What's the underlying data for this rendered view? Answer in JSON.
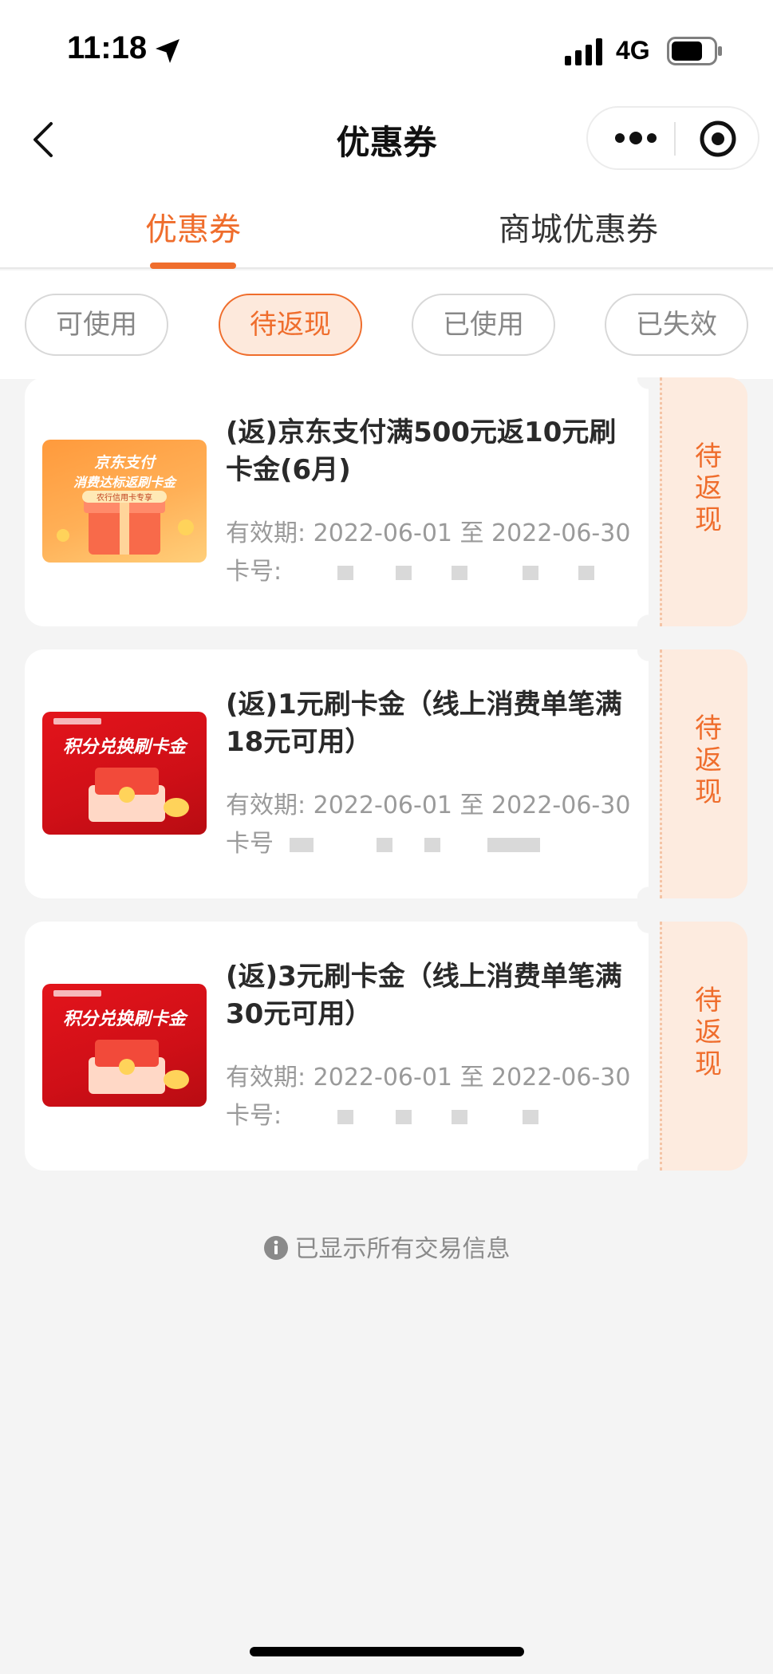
{
  "status_bar": {
    "time": "11:18",
    "network": "4G"
  },
  "nav": {
    "title": "优惠券"
  },
  "tabs": [
    {
      "label": "优惠券"
    },
    {
      "label": "商城优惠券"
    }
  ],
  "filters": [
    {
      "label": "可使用"
    },
    {
      "label": "待返现"
    },
    {
      "label": "已使用"
    },
    {
      "label": "已失效"
    }
  ],
  "coupons": [
    {
      "title": "(返)京东支付满500元返10元刷卡金(6月)",
      "validity": "有效期: 2022-06-01 至 2022-06-30",
      "card": "卡号:",
      "status": "待返现",
      "image": {
        "line1": "京东支付",
        "line2": "消费达标返刷卡金",
        "line3": "农行信用卡专享"
      }
    },
    {
      "title": "(返)1元刷卡金（线上消费单笔满18元可用）",
      "validity": "有效期: 2022-06-01 至 2022-06-30",
      "card": "卡号",
      "status": "待返现",
      "image": {
        "line1": "积分兑换刷卡金"
      }
    },
    {
      "title": "(返)3元刷卡金（线上消费单笔满30元可用）",
      "validity": "有效期: 2022-06-01 至 2022-06-30",
      "card": "卡号:",
      "status": "待返现",
      "image": {
        "line1": "积分兑换刷卡金"
      }
    }
  ],
  "footer": {
    "note": "已显示所有交易信息"
  },
  "colors": {
    "accent": "#ef6d2c",
    "stub_bg": "#fdebdf",
    "background": "#f4f4f4"
  },
  "icons": [
    "location-arrow-icon",
    "signal-icon",
    "battery-icon",
    "back-icon",
    "more-icon",
    "close-target-icon",
    "info-icon"
  ]
}
